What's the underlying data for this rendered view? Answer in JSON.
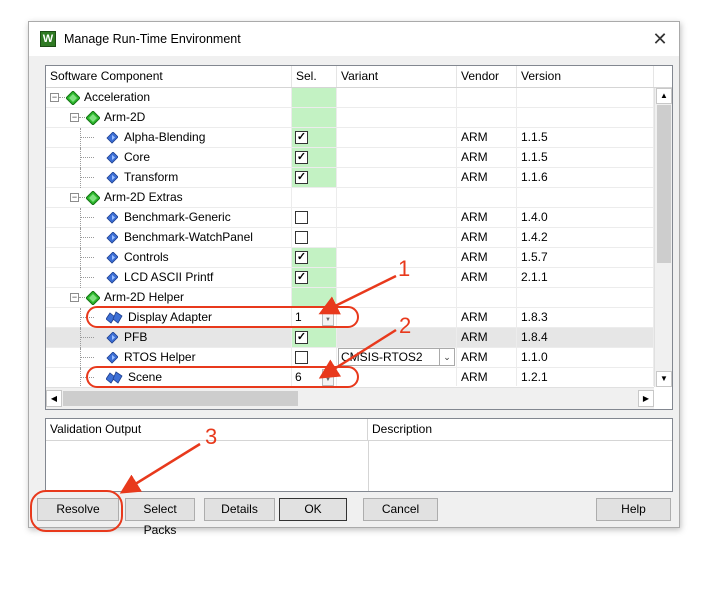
{
  "window": {
    "title": "Manage Run-Time Environment",
    "app_icon_letter": "W"
  },
  "grid": {
    "columns": [
      "Software Component",
      "Sel.",
      "Variant",
      "Vendor",
      "Version"
    ],
    "rows": [
      {
        "name": "Acceleration",
        "level": 0,
        "type": "group",
        "expanded": true,
        "sel_green": true,
        "checked": false,
        "vendor": "",
        "version": ""
      },
      {
        "name": "Arm-2D",
        "level": 1,
        "type": "group",
        "expanded": true,
        "sel_green": true,
        "checked": false,
        "vendor": "",
        "version": ""
      },
      {
        "name": "Alpha-Blending",
        "level": 2,
        "type": "item",
        "checked": true,
        "sel_green": true,
        "vendor": "ARM",
        "version": "1.1.5"
      },
      {
        "name": "Core",
        "level": 2,
        "type": "item",
        "checked": true,
        "sel_green": true,
        "vendor": "ARM",
        "version": "1.1.5"
      },
      {
        "name": "Transform",
        "level": 2,
        "type": "item",
        "checked": true,
        "sel_green": true,
        "vendor": "ARM",
        "version": "1.1.6"
      },
      {
        "name": "Arm-2D Extras",
        "level": 1,
        "type": "group",
        "expanded": true,
        "sel_green": false,
        "checked": false,
        "vendor": "",
        "version": ""
      },
      {
        "name": "Benchmark-Generic",
        "level": 2,
        "type": "item",
        "checked": false,
        "sel_green": false,
        "vendor": "ARM",
        "version": "1.4.0"
      },
      {
        "name": "Benchmark-WatchPanel",
        "level": 2,
        "type": "item",
        "checked": false,
        "sel_green": false,
        "vendor": "ARM",
        "version": "1.4.2"
      },
      {
        "name": "Controls",
        "level": 2,
        "type": "item",
        "checked": true,
        "sel_green": true,
        "vendor": "ARM",
        "version": "1.5.7"
      },
      {
        "name": "LCD ASCII Printf",
        "level": 2,
        "type": "item",
        "checked": true,
        "sel_green": true,
        "vendor": "ARM",
        "version": "2.1.1"
      },
      {
        "name": "Arm-2D Helper",
        "level": 1,
        "type": "group",
        "expanded": true,
        "sel_green": true,
        "checked": false,
        "vendor": "",
        "version": ""
      },
      {
        "name": "Display Adapter",
        "level": 2,
        "type": "multi",
        "spin": "1",
        "sel_green": true,
        "vendor": "ARM",
        "version": "1.8.3"
      },
      {
        "name": "PFB",
        "level": 2,
        "type": "item",
        "checked": true,
        "sel_green": true,
        "vendor": "ARM",
        "version": "1.8.4",
        "selected": true
      },
      {
        "name": "RTOS Helper",
        "level": 2,
        "type": "item",
        "checked": false,
        "sel_green": false,
        "vendor": "ARM",
        "version": "1.1.0",
        "variant": "CMSIS-RTOS2"
      },
      {
        "name": "Scene",
        "level": 2,
        "type": "multi",
        "spin": "6",
        "sel_green": true,
        "vendor": "ARM",
        "version": "1.2.1"
      }
    ]
  },
  "validation": {
    "col_output": "Validation Output",
    "col_description": "Description"
  },
  "buttons": {
    "resolve": "Resolve",
    "select_packs": "Select Packs",
    "details": "Details",
    "ok": "OK",
    "cancel": "Cancel",
    "help": "Help"
  },
  "annotations": {
    "n1": "1",
    "n2": "2",
    "n3": "3"
  },
  "colors": {
    "annotation": "#e8391c",
    "sel_green": "#c3f2c3",
    "gem_green": "#2db82d",
    "gem_blue": "#3d6fd6"
  }
}
